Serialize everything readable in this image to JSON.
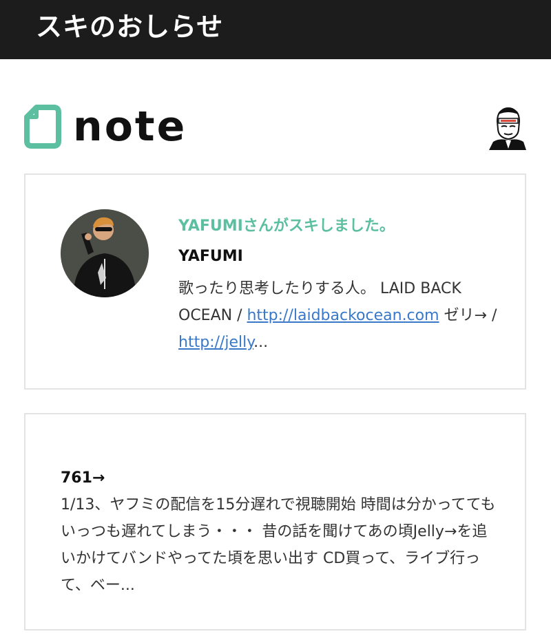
{
  "header": {
    "title": "スキのおしらせ"
  },
  "brand": {
    "logo_text": "note",
    "logo_color": "#5bbfa0"
  },
  "icons": {
    "logo": "note-logo-icon",
    "account": "account-avatar-icon",
    "user": "user-avatar"
  },
  "notification": {
    "like_text": "YAFUMIさんがスキしました。",
    "user_name": "YAFUMI",
    "bio_text_1": "歌ったり思考したりする人。 LAID BACK OCEAN / ",
    "bio_link_1": "http://laidbackocean.com",
    "bio_text_2": " ゼリ→ / ",
    "bio_link_2": "http://jelly",
    "bio_text_3": "..."
  },
  "post": {
    "title": "761→",
    "excerpt": "1/13、ヤフミの配信を15分遅れで視聴開始 時間は分かっててもいっつも遅れてしまう・・・ 昔の話を聞けてあの頃Jelly→を追いかけてバンドやってた頃を思い出す CD買って、ライブ行って、ベー..."
  },
  "colors": {
    "topbar": "#1c1c1c",
    "accent": "#5bbfa0",
    "link": "#3978c8",
    "card_border": "#e3e3e3"
  }
}
